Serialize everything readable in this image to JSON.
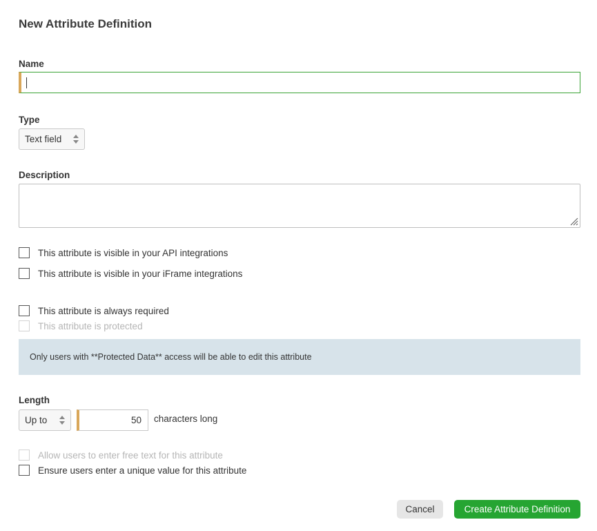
{
  "dialog": {
    "title": "New Attribute Definition"
  },
  "name": {
    "label": "Name",
    "value": ""
  },
  "type": {
    "label": "Type",
    "selected": "Text field"
  },
  "description": {
    "label": "Description",
    "value": ""
  },
  "checkboxes": {
    "api_visible": {
      "label": "This attribute is visible in your API integrations",
      "checked": false
    },
    "iframe_visible": {
      "label": "This attribute is visible in your iFrame integrations",
      "checked": false
    },
    "always_required": {
      "label": "This attribute is always required",
      "checked": false
    },
    "protected": {
      "label": "This attribute is protected",
      "checked": false,
      "disabled": true
    },
    "free_text": {
      "label": "Allow users to enter free text for this attribute",
      "checked": false,
      "disabled": true
    },
    "unique_value": {
      "label": "Ensure users enter a unique value for this attribute",
      "checked": false
    }
  },
  "notice": {
    "text": "Only users with **Protected Data** access will be able to edit this attribute"
  },
  "length": {
    "label": "Length",
    "mode": "Up to",
    "value": "50",
    "suffix": "characters long"
  },
  "actions": {
    "cancel": "Cancel",
    "create": "Create Attribute Definition"
  },
  "colors": {
    "accent_green": "#26a532",
    "focus_border": "#3aa335",
    "required_marker": "#d9a75a",
    "notice_bg": "#d7e3ea"
  }
}
